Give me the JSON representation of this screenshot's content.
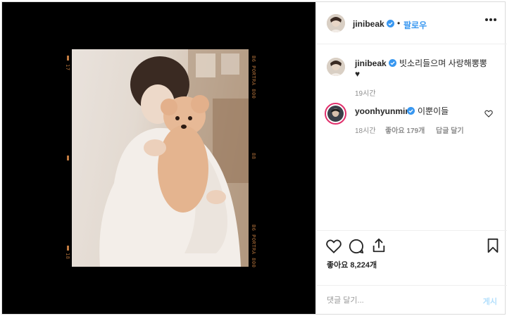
{
  "post": {
    "author": "jinibeak",
    "follow_separator": "•",
    "follow_label": "팔로우",
    "media": {
      "film_labels": {
        "left_top": "17",
        "left_bottom": "18",
        "right_top": "B6 PORTRA 800",
        "right_mid": "88",
        "right_bottom": "B6 PORTRA 800"
      }
    }
  },
  "comments": [
    {
      "username": "jinibeak",
      "text_line1": "빗소리들으며 사랑해뽕뽕",
      "text_line2": "♥",
      "time": "19시간"
    },
    {
      "username": "yoonhyunmin",
      "text": "이뿐이들",
      "time": "18시간",
      "likes": "좋아요 179개",
      "reply_label": "답글 달기"
    }
  ],
  "actions": {
    "likes_text": "좋아요 8,224개"
  },
  "add_comment": {
    "placeholder": "댓글 달기...",
    "post_label": "게시"
  },
  "colors": {
    "verified": "#3897f0",
    "follow": "#3897f0",
    "film_orange": "#c07a40"
  }
}
